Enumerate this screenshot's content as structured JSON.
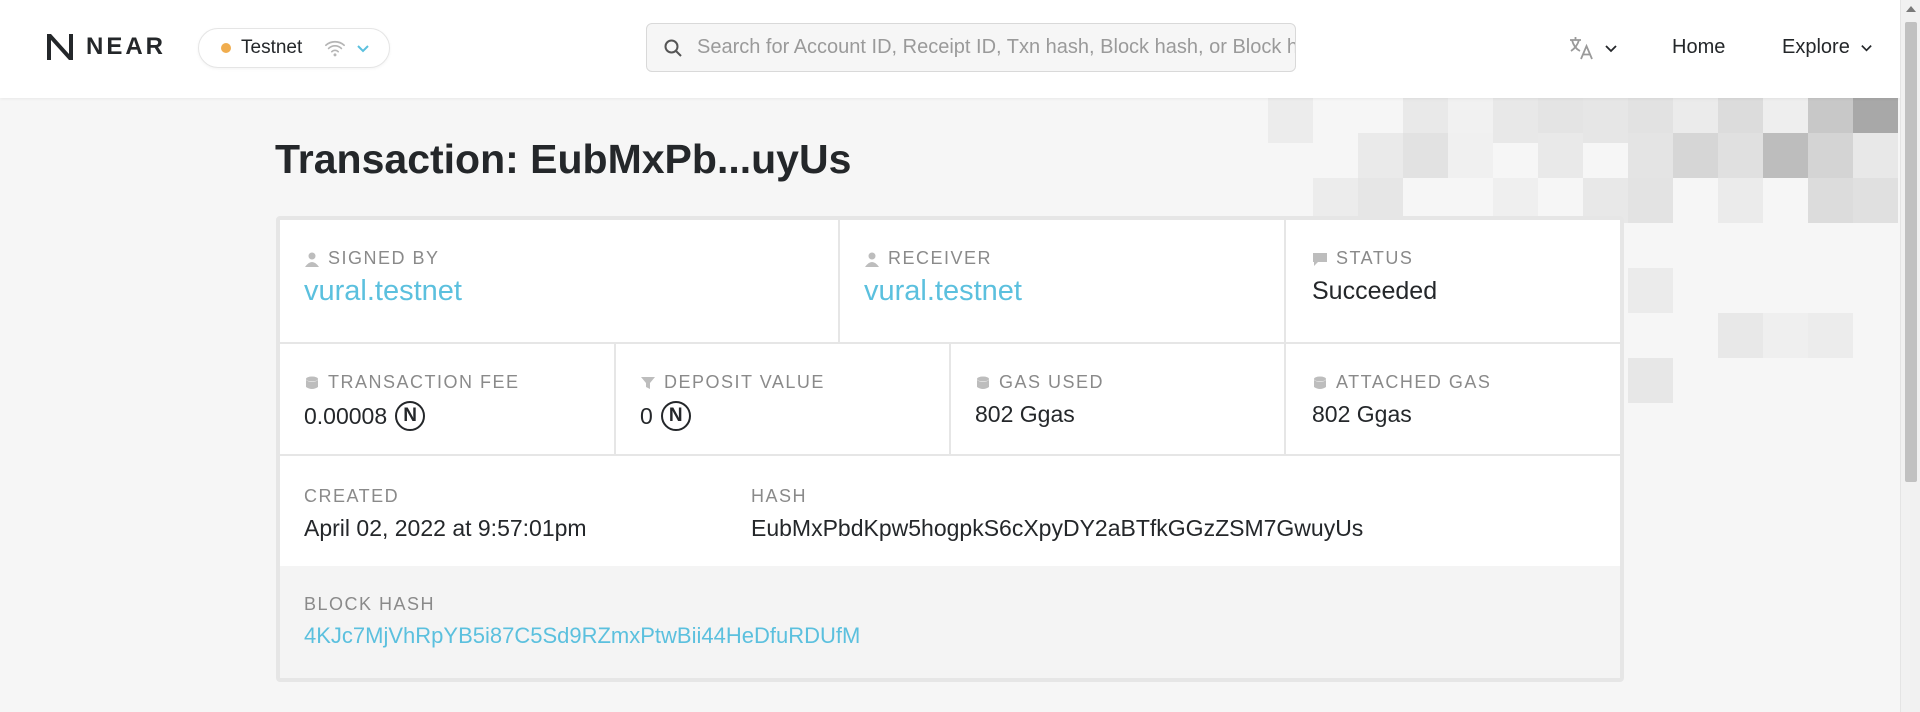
{
  "header": {
    "logo_text": "NEAR",
    "network": "Testnet",
    "search_placeholder": "Search for Account ID, Receipt ID, Txn hash, Block hash, or Block height",
    "nav_home": "Home",
    "nav_explore": "Explore"
  },
  "page": {
    "title": "Transaction: EubMxPb...uyUs"
  },
  "transaction": {
    "signed_by_label": "SIGNED BY",
    "signed_by": "vural.testnet",
    "receiver_label": "RECEIVER",
    "receiver": "vural.testnet",
    "status_label": "STATUS",
    "status": "Succeeded",
    "fee_label": "TRANSACTION FEE",
    "fee": "0.00008",
    "deposit_label": "DEPOSIT VALUE",
    "deposit": "0",
    "gas_used_label": "GAS USED",
    "gas_used": "802 Ggas",
    "attached_gas_label": "ATTACHED GAS",
    "attached_gas": "802 Ggas",
    "created_label": "CREATED",
    "created": "April 02, 2022 at 9:57:01pm",
    "hash_label": "HASH",
    "hash": "EubMxPbdKpw5hogpkS6cXpyDY2aBTfkGGzZSM7GwuyUs",
    "block_hash_label": "BLOCK HASH",
    "block_hash": "4KJc7MjVhRpYB5i87C5Sd9RZmxPtwBii44HeDfuRDUfM",
    "near_symbol": "N"
  },
  "colors": {
    "accent": "#5bc0de",
    "network_dot": "#f0ad4e",
    "text": "#24272a",
    "muted": "#8a8a8a"
  }
}
